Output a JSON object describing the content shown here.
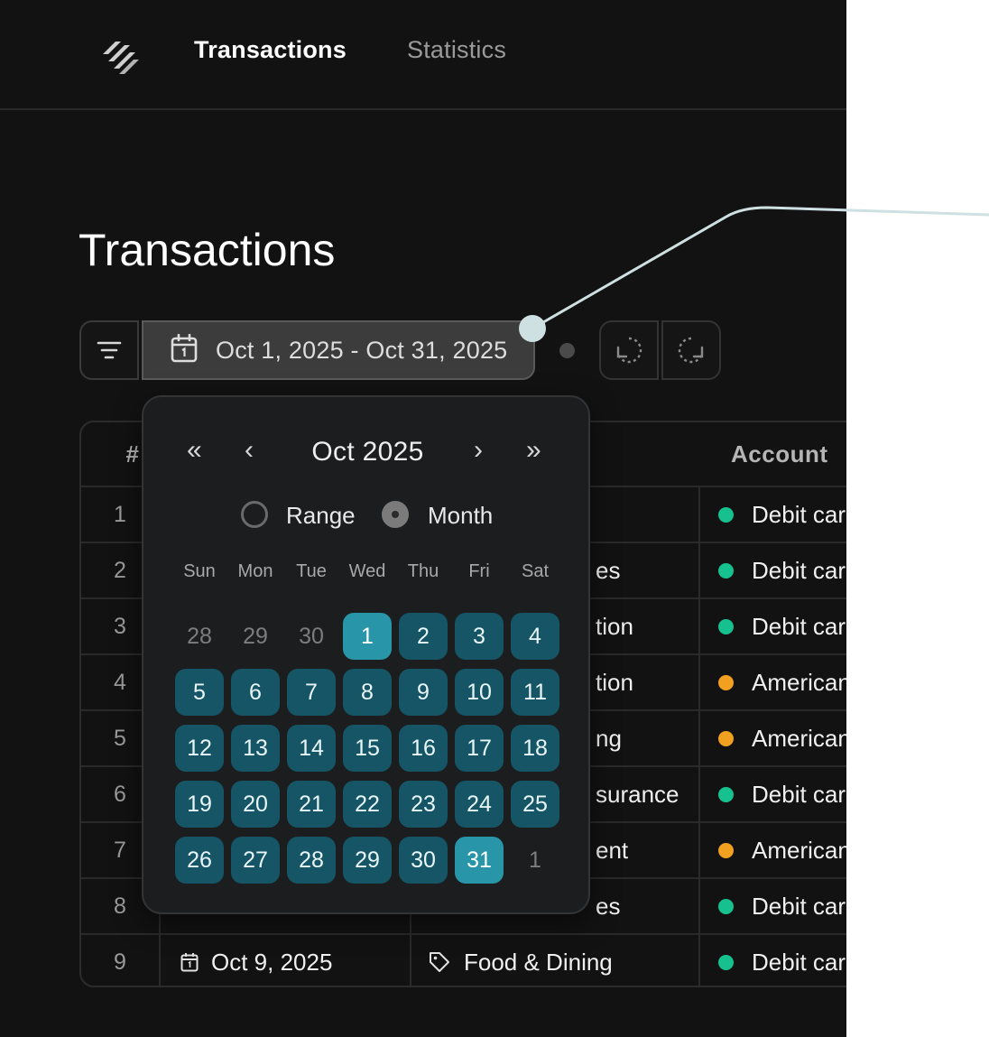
{
  "nav": {
    "links": [
      "Transactions",
      "Statistics"
    ]
  },
  "page": {
    "title": "Transactions"
  },
  "toolbar": {
    "date_range": "Oct 1, 2025 - Oct 31, 2025"
  },
  "table": {
    "headers": {
      "num": "#",
      "account": "Account"
    },
    "rows": [
      {
        "num": "1",
        "date": "",
        "category": "",
        "account": "Debit car",
        "dot": "#17c08f"
      },
      {
        "num": "2",
        "date": "",
        "category": "es",
        "account": "Debit car",
        "dot": "#17c08f"
      },
      {
        "num": "3",
        "date": "",
        "category": "tion",
        "account": "Debit car",
        "dot": "#17c08f"
      },
      {
        "num": "4",
        "date": "",
        "category": "tion",
        "account": "American",
        "dot": "#f2a01f"
      },
      {
        "num": "5",
        "date": "",
        "category": "ng",
        "account": "American",
        "dot": "#f2a01f"
      },
      {
        "num": "6",
        "date": "",
        "category": "surance",
        "account": "Debit car",
        "dot": "#17c08f"
      },
      {
        "num": "7",
        "date": "",
        "category": "ent",
        "account": "American",
        "dot": "#f2a01f"
      },
      {
        "num": "8",
        "date": "",
        "category": "es",
        "account": "Debit car",
        "dot": "#17c08f"
      },
      {
        "num": "9",
        "date": "Oct 9, 2025",
        "category": "Food & Dining",
        "account": "Debit car",
        "dot": "#17c08f"
      }
    ]
  },
  "calendar": {
    "month_label": "Oct 2025",
    "nav": {
      "prev_year": "«",
      "prev_month": "‹",
      "next_month": "›",
      "next_year": "»"
    },
    "mode": {
      "range_label": "Range",
      "month_label": "Month",
      "selected": "Month"
    },
    "weekdays": [
      "Sun",
      "Mon",
      "Tue",
      "Wed",
      "Thu",
      "Fri",
      "Sat"
    ],
    "weeks": [
      [
        {
          "d": "28",
          "t": "outside"
        },
        {
          "d": "29",
          "t": "outside"
        },
        {
          "d": "30",
          "t": "outside"
        },
        {
          "d": "1",
          "t": "endpoint"
        },
        {
          "d": "2",
          "t": "inmonth"
        },
        {
          "d": "3",
          "t": "inmonth"
        },
        {
          "d": "4",
          "t": "inmonth"
        }
      ],
      [
        {
          "d": "5",
          "t": "inmonth"
        },
        {
          "d": "6",
          "t": "inmonth"
        },
        {
          "d": "7",
          "t": "inmonth"
        },
        {
          "d": "8",
          "t": "inmonth"
        },
        {
          "d": "9",
          "t": "inmonth"
        },
        {
          "d": "10",
          "t": "inmonth"
        },
        {
          "d": "11",
          "t": "inmonth"
        }
      ],
      [
        {
          "d": "12",
          "t": "inmonth"
        },
        {
          "d": "13",
          "t": "inmonth"
        },
        {
          "d": "14",
          "t": "inmonth"
        },
        {
          "d": "15",
          "t": "inmonth"
        },
        {
          "d": "16",
          "t": "inmonth"
        },
        {
          "d": "17",
          "t": "inmonth"
        },
        {
          "d": "18",
          "t": "inmonth"
        }
      ],
      [
        {
          "d": "19",
          "t": "inmonth"
        },
        {
          "d": "20",
          "t": "inmonth"
        },
        {
          "d": "21",
          "t": "inmonth"
        },
        {
          "d": "22",
          "t": "inmonth"
        },
        {
          "d": "23",
          "t": "inmonth"
        },
        {
          "d": "24",
          "t": "inmonth"
        },
        {
          "d": "25",
          "t": "inmonth"
        }
      ],
      [
        {
          "d": "26",
          "t": "inmonth"
        },
        {
          "d": "27",
          "t": "inmonth"
        },
        {
          "d": "28",
          "t": "inmonth"
        },
        {
          "d": "29",
          "t": "inmonth"
        },
        {
          "d": "30",
          "t": "inmonth"
        },
        {
          "d": "31",
          "t": "endpoint"
        },
        {
          "d": "1",
          "t": "outside"
        }
      ]
    ]
  },
  "colors": {
    "background": "#121212",
    "accent_selected": "#2896a8",
    "accent_range": "#155565",
    "status_green": "#17c08f",
    "status_orange": "#f2a01f"
  }
}
